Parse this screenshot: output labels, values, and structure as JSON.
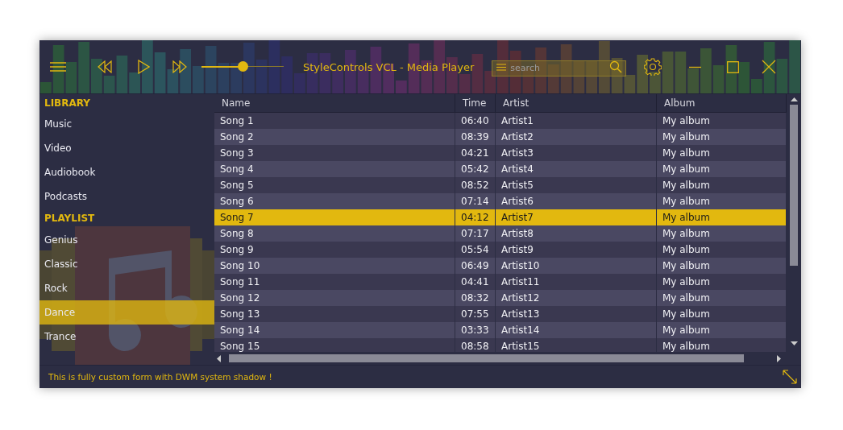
{
  "window": {
    "title": "StyleControls VCL - Media Player"
  },
  "player": {
    "volume": {
      "level": 0.5
    }
  },
  "search": {
    "placeholder": "search"
  },
  "sidebar": [
    {
      "kind": "header",
      "label": "LIBRARY"
    },
    {
      "kind": "item",
      "label": "Music",
      "selected": false
    },
    {
      "kind": "item",
      "label": "Video",
      "selected": false
    },
    {
      "kind": "item",
      "label": "Audiobook",
      "selected": false
    },
    {
      "kind": "item",
      "label": "Podcasts",
      "selected": false
    },
    {
      "kind": "header",
      "label": "PLAYLIST"
    },
    {
      "kind": "item",
      "label": "Genius",
      "selected": false
    },
    {
      "kind": "item",
      "label": "Classic",
      "selected": false
    },
    {
      "kind": "item",
      "label": "Rock",
      "selected": false
    },
    {
      "kind": "item",
      "label": "Dance",
      "selected": true
    },
    {
      "kind": "item",
      "label": "Trance",
      "selected": false
    }
  ],
  "table": {
    "columns": [
      "Name",
      "Time",
      "Artist",
      "Album"
    ],
    "rows": [
      {
        "cells": [
          "Song 1",
          "06:40",
          "Artist1",
          "My album"
        ],
        "selected": false
      },
      {
        "cells": [
          "Song 2",
          "08:39",
          "Artist2",
          "My album"
        ],
        "selected": false
      },
      {
        "cells": [
          "Song 3",
          "04:21",
          "Artist3",
          "My album"
        ],
        "selected": false
      },
      {
        "cells": [
          "Song 4",
          "05:42",
          "Artist4",
          "My album"
        ],
        "selected": false
      },
      {
        "cells": [
          "Song 5",
          "08:52",
          "Artist5",
          "My album"
        ],
        "selected": false
      },
      {
        "cells": [
          "Song 6",
          "07:14",
          "Artist6",
          "My album"
        ],
        "selected": false
      },
      {
        "cells": [
          "Song 7",
          "04:12",
          "Artist7",
          "My album"
        ],
        "selected": true
      },
      {
        "cells": [
          "Song 8",
          "07:17",
          "Artist8",
          "My album"
        ],
        "selected": false
      },
      {
        "cells": [
          "Song 9",
          "05:54",
          "Artist9",
          "My album"
        ],
        "selected": false
      },
      {
        "cells": [
          "Song 10",
          "06:49",
          "Artist10",
          "My album"
        ],
        "selected": false
      },
      {
        "cells": [
          "Song 11",
          "04:41",
          "Artist11",
          "My album"
        ],
        "selected": false
      },
      {
        "cells": [
          "Song 12",
          "08:32",
          "Artist12",
          "My album"
        ],
        "selected": false
      },
      {
        "cells": [
          "Song 13",
          "07:55",
          "Artist13",
          "My album"
        ],
        "selected": false
      },
      {
        "cells": [
          "Song 14",
          "03:33",
          "Artist14",
          "My album"
        ],
        "selected": false
      },
      {
        "cells": [
          "Song 15",
          "08:58",
          "Artist15",
          "My album"
        ],
        "selected": false
      }
    ]
  },
  "status_bar": {
    "text": "This is fully custom form with DWM system shadow !"
  }
}
